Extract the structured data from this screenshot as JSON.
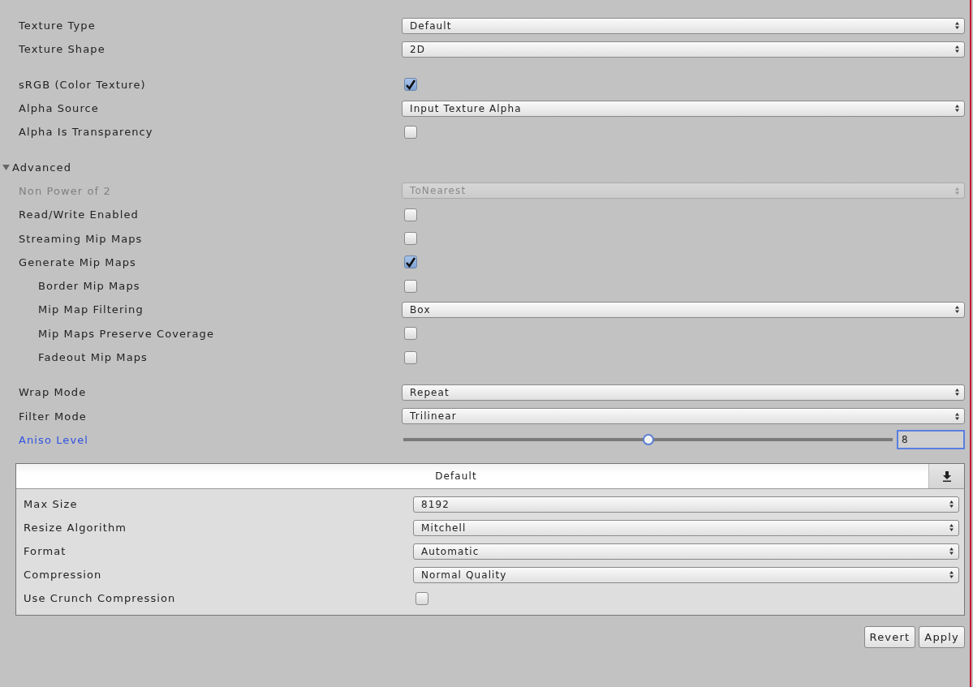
{
  "sections": [
    {
      "rows": [
        {
          "kind": "dropdown",
          "label": "Texture Type",
          "value": "Default",
          "disabled": false
        },
        {
          "kind": "dropdown",
          "label": "Texture Shape",
          "value": "2D",
          "disabled": false
        }
      ]
    },
    {
      "rows": [
        {
          "kind": "checkbox",
          "label": "sRGB (Color Texture)",
          "checked": true
        },
        {
          "kind": "dropdown",
          "label": "Alpha Source",
          "value": "Input Texture Alpha",
          "disabled": false
        },
        {
          "kind": "checkbox",
          "label": "Alpha Is Transparency",
          "checked": false
        }
      ]
    },
    {
      "rows": [
        {
          "kind": "foldout",
          "label": "Advanced",
          "expanded": true,
          "children": [
            {
              "kind": "dropdown",
              "label": "Non Power of 2",
              "value": "ToNearest",
              "disabled": true
            },
            {
              "kind": "checkbox",
              "label": "Read/Write Enabled",
              "checked": false
            },
            {
              "kind": "checkbox",
              "label": "Streaming Mip Maps",
              "checked": false
            },
            {
              "kind": "checkbox",
              "label": "Generate Mip Maps",
              "checked": true,
              "children": [
                {
                  "kind": "checkbox",
                  "label": "Border Mip Maps",
                  "checked": false
                },
                {
                  "kind": "dropdown",
                  "label": "Mip Map Filtering",
                  "value": "Box",
                  "disabled": false
                },
                {
                  "kind": "checkbox",
                  "label": "Mip Maps Preserve Coverage",
                  "checked": false
                },
                {
                  "kind": "checkbox",
                  "label": "Fadeout Mip Maps",
                  "checked": false
                }
              ]
            }
          ]
        }
      ]
    },
    {
      "rows": [
        {
          "kind": "dropdown",
          "label": "Wrap Mode",
          "value": "Repeat",
          "disabled": false
        },
        {
          "kind": "dropdown",
          "label": "Filter Mode",
          "value": "Trilinear",
          "disabled": false
        },
        {
          "kind": "slider",
          "label": "Aniso Level",
          "level": 0.5,
          "value": "8",
          "focused": true
        }
      ]
    }
  ],
  "platform_panel": {
    "title": "Default",
    "rows": [
      {
        "kind": "dropdown",
        "label": "Max Size",
        "value": "8192",
        "disabled": false
      },
      {
        "kind": "dropdown",
        "label": "Resize Algorithm",
        "value": "Mitchell",
        "disabled": false
      },
      {
        "kind": "dropdown",
        "label": "Format",
        "value": "Automatic",
        "disabled": false
      },
      {
        "kind": "dropdown",
        "label": "Compression",
        "value": "Normal Quality",
        "disabled": false
      },
      {
        "kind": "checkbox",
        "label": "Use Crunch Compression",
        "checked": false
      }
    ]
  },
  "buttons": [
    "Revert",
    "Apply"
  ]
}
